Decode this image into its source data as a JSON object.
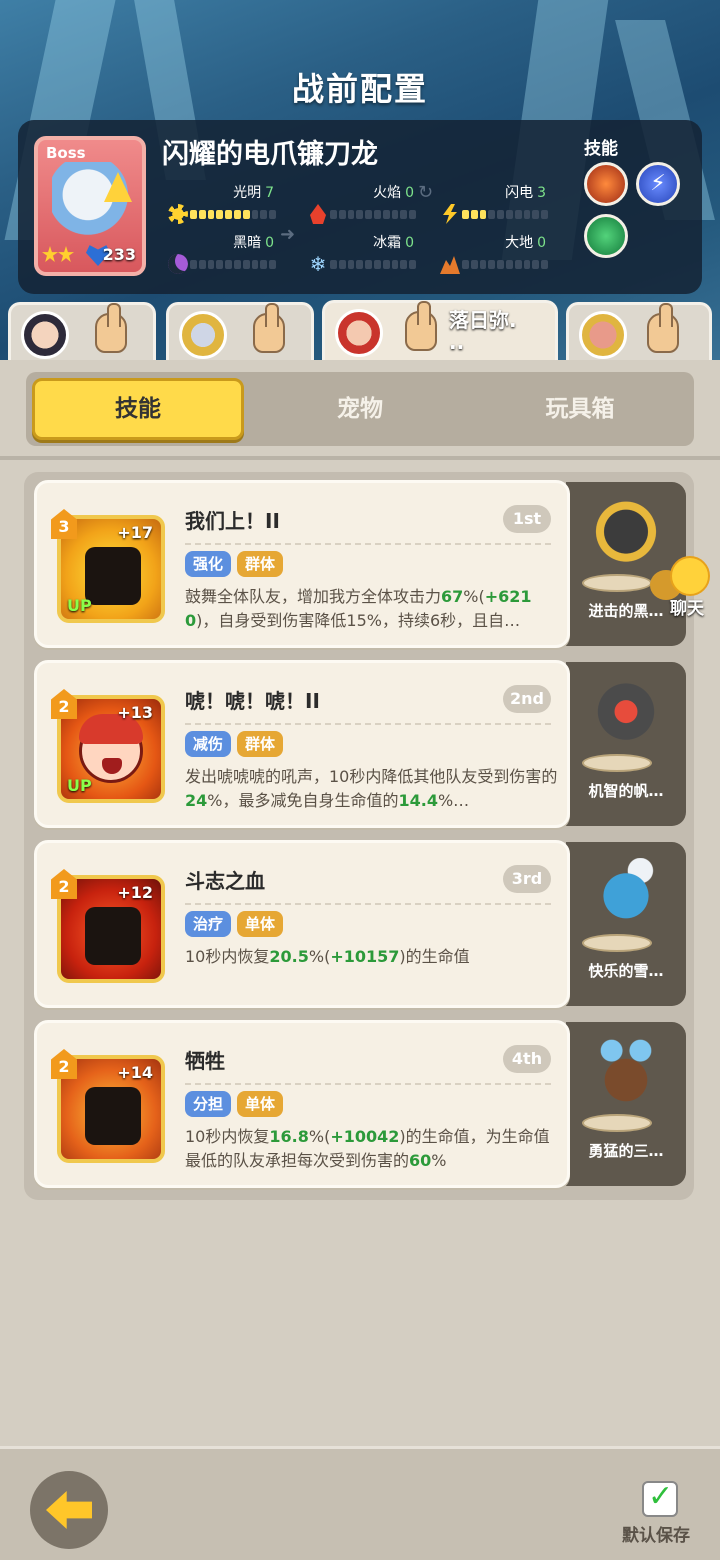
{
  "header": {
    "title": "战前配置"
  },
  "boss": {
    "tag": "Boss",
    "name": "闪耀的电爪镰刀龙",
    "level": "233",
    "skills_label": "技能",
    "elements": [
      {
        "label": "光明",
        "value": "7",
        "level": 7,
        "icon": "sun-icon"
      },
      {
        "label": "火焰",
        "value": "0",
        "level": 0,
        "icon": "fire-icon"
      },
      {
        "label": "闪电",
        "value": "3",
        "level": 3,
        "icon": "lightning-icon"
      },
      {
        "label": "黑暗",
        "value": "0",
        "level": 0,
        "icon": "moon-icon"
      },
      {
        "label": "冰霜",
        "value": "0",
        "level": 0,
        "icon": "snowflake-icon"
      },
      {
        "label": "大地",
        "value": "0",
        "level": 0,
        "icon": "mountain-icon"
      }
    ]
  },
  "team": {
    "active_name": "落日弥.\n.."
  },
  "tabs": [
    {
      "label": "技能",
      "active": true
    },
    {
      "label": "宠物",
      "active": false
    },
    {
      "label": "玩具箱",
      "active": false
    }
  ],
  "skills": [
    {
      "level": "3",
      "plus": "+17",
      "up": "UP",
      "title": "我们上！II",
      "rank": "1st",
      "tags": [
        "强化",
        "群体"
      ],
      "desc_parts": [
        "鼓舞全体队友，增加我方全体攻击力",
        "67",
        "%(",
        "+6210",
        ")，自身受到伤害降低15%，持续6秒，且自…"
      ],
      "pet": "进击的黑…"
    },
    {
      "level": "2",
      "plus": "+13",
      "up": "UP",
      "title": "唬！唬！唬！II",
      "rank": "2nd",
      "tags": [
        "减伤",
        "群体"
      ],
      "desc_parts": [
        "发出唬唬唬的吼声，10秒内降低其他队友受到伤害的",
        "24",
        "%，最多减免自身生命值的",
        "14.4",
        "%…"
      ],
      "pet": "机智的帆…"
    },
    {
      "level": "2",
      "plus": "+12",
      "up": "",
      "title": "斗志之血",
      "rank": "3rd",
      "tags": [
        "治疗",
        "单体"
      ],
      "desc_parts": [
        "10秒内恢复",
        "20.5",
        "%(",
        "+10157",
        ")的生命值"
      ],
      "pet": "快乐的雪…"
    },
    {
      "level": "2",
      "plus": "+14",
      "up": "",
      "title": "牺牲",
      "rank": "4th",
      "tags": [
        "分担",
        "单体"
      ],
      "desc_parts": [
        "10秒内恢复",
        "16.8",
        "%(",
        "+10042",
        ")的生命值，为生命值最低的队友承担每次受到伤害的",
        "60",
        "%"
      ],
      "pet": "勇猛的三…"
    }
  ],
  "chat": {
    "label": "聊天"
  },
  "bottom": {
    "save_label": "默认保存"
  }
}
